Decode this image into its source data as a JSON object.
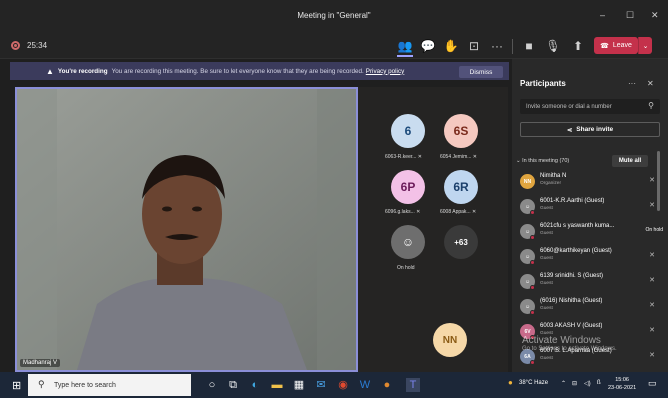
{
  "window": {
    "title": "Meeting in \"General\"",
    "controls": [
      "minimize-icon",
      "maximize-icon",
      "close-icon"
    ]
  },
  "callbar": {
    "timer": "25:34",
    "leave_label": "Leave"
  },
  "banner": {
    "heading": "You're recording",
    "message": "You are recording this meeting. Be sure to let everyone know that they are being recorded.",
    "policy_link": "Privacy policy",
    "dismiss_label": "Dismiss"
  },
  "stage": {
    "main_speaker": "Madhanraj V"
  },
  "tiles": [
    {
      "initials": "6",
      "label": "6063-R.keer...",
      "bg": "#c9dcef",
      "fg": "#1b4a7a"
    },
    {
      "initials": "6S",
      "label": "6054 Jemim...",
      "bg": "#f5c9c0",
      "fg": "#7a2a1b"
    },
    {
      "initials": "6P",
      "label": "6096.g.laks...",
      "bg": "#f3c1e7",
      "fg": "#6b1b5a"
    },
    {
      "initials": "6R",
      "label": "6008 Appak...",
      "bg": "#bfd6ef",
      "fg": "#1b3f6b"
    },
    {
      "initials": "",
      "label": "On hold",
      "bg": "#6e6e6e",
      "fg": "#fff"
    },
    {
      "initials": "+63",
      "label": "",
      "bg": "#3a3a3a",
      "fg": "#fff"
    },
    {
      "initials": "NN",
      "label": "",
      "bg": "#f6d8a8",
      "fg": "#8a5a14"
    }
  ],
  "participants": {
    "title": "Participants",
    "invite_placeholder": "Invite someone or dial a number",
    "share_invite_label": "Share invite",
    "in_meeting_label": "In this meeting (70)",
    "mute_all_label": "Mute all",
    "list": [
      {
        "initials": "NN",
        "name": "Nimitha N",
        "role": "Organizer",
        "avatar_color": "#e0a53f",
        "extra": ""
      },
      {
        "initials": "",
        "name": "6001-K.R.Aarthi (Guest)",
        "role": "Guest",
        "avatar_color": "#8a8a8a",
        "extra": ""
      },
      {
        "initials": "",
        "name": "6021cfu s yaswanth kuma...",
        "role": "Guest",
        "avatar_color": "#8a8a8a",
        "extra": "On hold"
      },
      {
        "initials": "",
        "name": "6060@karthikeyan (Guest)",
        "role": "Guest",
        "avatar_color": "#8a8a8a",
        "extra": ""
      },
      {
        "initials": "",
        "name": "6139 srinidhi. S (Guest)",
        "role": "Guest",
        "avatar_color": "#8a8a8a",
        "extra": ""
      },
      {
        "initials": "",
        "name": "(6016) Nishitha (Guest)",
        "role": "Guest",
        "avatar_color": "#8a8a8a",
        "extra": ""
      },
      {
        "initials": "6V",
        "name": "6003 AKASH V (Guest)",
        "role": "Guest",
        "avatar_color": "#c86a8a",
        "extra": ""
      },
      {
        "initials": "6A",
        "name": "6007 S. L.Aparnaa (Guest)",
        "role": "Guest",
        "avatar_color": "#7a8aa8",
        "extra": ""
      }
    ]
  },
  "watermark": {
    "line1": "Activate Windows",
    "line2": "Go to Settings to activate Windows."
  },
  "taskbar": {
    "search_placeholder": "Type here to search",
    "weather": "38°C Haze",
    "time": "15:06",
    "date": "23-06-2021"
  }
}
